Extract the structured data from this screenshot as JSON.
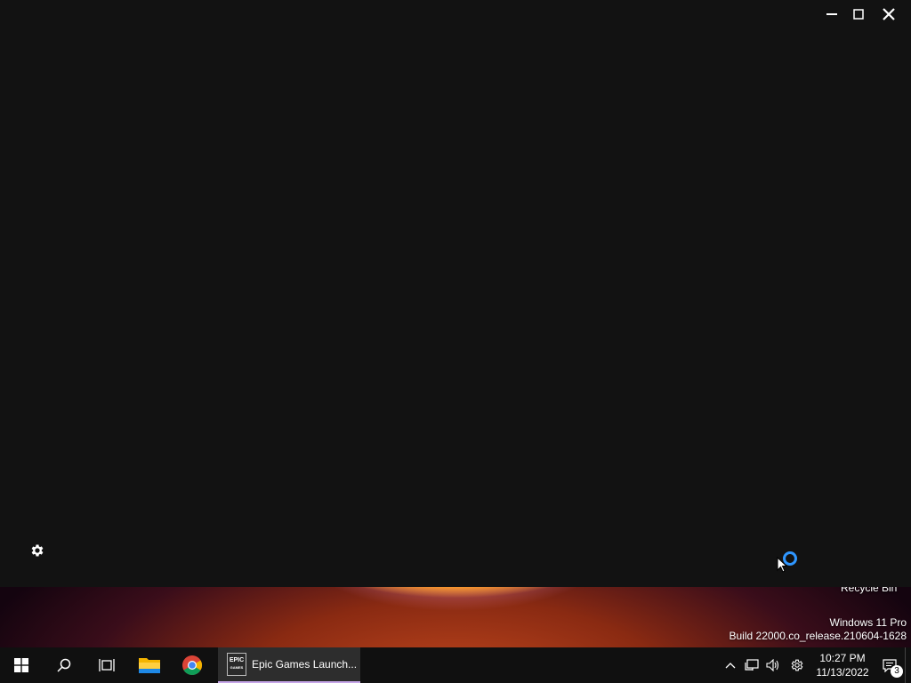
{
  "desktop": {
    "recycle_bin_label": "Recycle Bin",
    "watermark": {
      "edition": "Windows 11 Pro",
      "build": "Build 22000.co_release.210604-1628"
    }
  },
  "launcher": {
    "controls": {
      "minimize": "minimize-icon",
      "maximize": "maximize-icon",
      "close": "close-icon"
    },
    "settings_icon": "gear-icon",
    "loading_indicator": "spinner"
  },
  "taskbar": {
    "pinned": [
      "start-icon",
      "search-icon",
      "task-view-icon",
      "file-explorer-icon",
      "chrome-icon"
    ],
    "active_app": {
      "logo_line1": "EPIC",
      "logo_line2": "GAMES",
      "label": "Epic Games Launch..."
    },
    "tray": {
      "icons": [
        "chevron-up-icon",
        "network-icon",
        "volume-icon",
        "settings-tray-icon"
      ],
      "time": "10:27 PM",
      "date": "11/13/2022",
      "notification_count": "3"
    },
    "colors": {
      "accent_underline": "#c6a6e8",
      "spinner": "#2f96ff"
    }
  }
}
